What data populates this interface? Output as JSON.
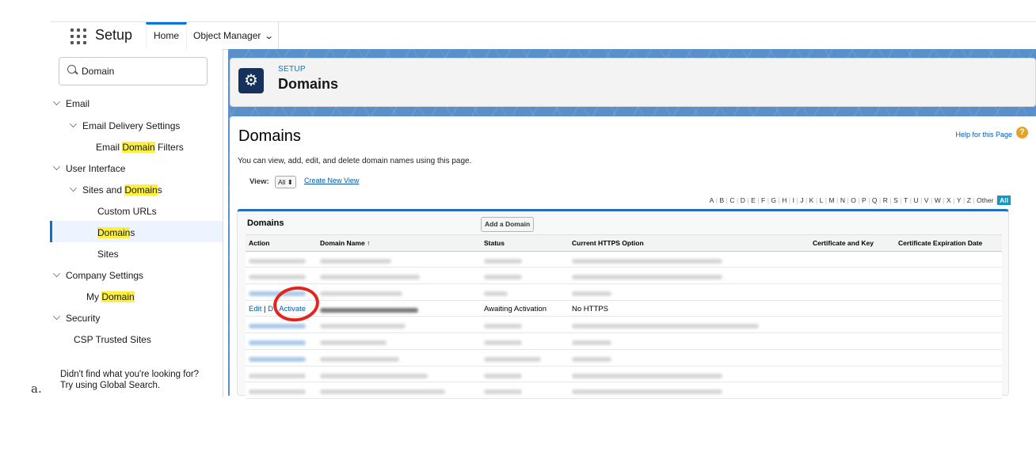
{
  "caption": "a.",
  "topbar": {
    "app_title": "Setup",
    "tabs": [
      {
        "label": "Home",
        "active": true
      },
      {
        "label": "Object Manager",
        "active": false
      }
    ]
  },
  "sidebar": {
    "search_value": "Domain",
    "items": [
      {
        "label": "Email"
      },
      {
        "label": "Email Delivery Settings"
      },
      {
        "pre": "Email ",
        "hl": "Domain",
        "post": " Filters"
      },
      {
        "label": "User Interface"
      },
      {
        "pre": "Sites and ",
        "hl": "Domain",
        "post": "s"
      },
      {
        "label": "Custom URLs"
      },
      {
        "pre": "",
        "hl": "Domain",
        "post": "s"
      },
      {
        "label": "Sites"
      },
      {
        "label": "Company Settings"
      },
      {
        "pre": "My ",
        "hl": "Domain",
        "post": ""
      },
      {
        "label": "Security"
      },
      {
        "label": "CSP Trusted Sites"
      }
    ],
    "footer_line1": "Didn't find what you're looking for?",
    "footer_line2": "Try using Global Search."
  },
  "header": {
    "eyebrow": "SETUP",
    "title": "Domains",
    "icon": "gear-icon"
  },
  "main": {
    "title": "Domains",
    "help_link": "Help for this Page",
    "description": "You can view, add, edit, and delete domain names using this page.",
    "view_label": "View:",
    "view_select": "All ⬍",
    "create_view": "Create New View",
    "alphabet": [
      "A",
      "B",
      "C",
      "D",
      "E",
      "F",
      "G",
      "H",
      "I",
      "J",
      "K",
      "L",
      "M",
      "N",
      "O",
      "P",
      "Q",
      "R",
      "S",
      "T",
      "U",
      "V",
      "W",
      "X",
      "Y",
      "Z",
      "Other",
      "All"
    ],
    "alphabet_selected": "All",
    "list_title": "Domains",
    "add_button": "Add a Domain",
    "columns": [
      "Action",
      "Domain Name ↑",
      "Status",
      "Current HTTPS Option",
      "Certificate and Key",
      "Certificate Expiration Date"
    ],
    "visible_row": {
      "edit": "Edit",
      "sep1": " | ",
      "del": "D",
      "sep2": "  | ",
      "activate": "Activate",
      "status": "Awaiting Activation",
      "https": "No HTTPS"
    }
  }
}
